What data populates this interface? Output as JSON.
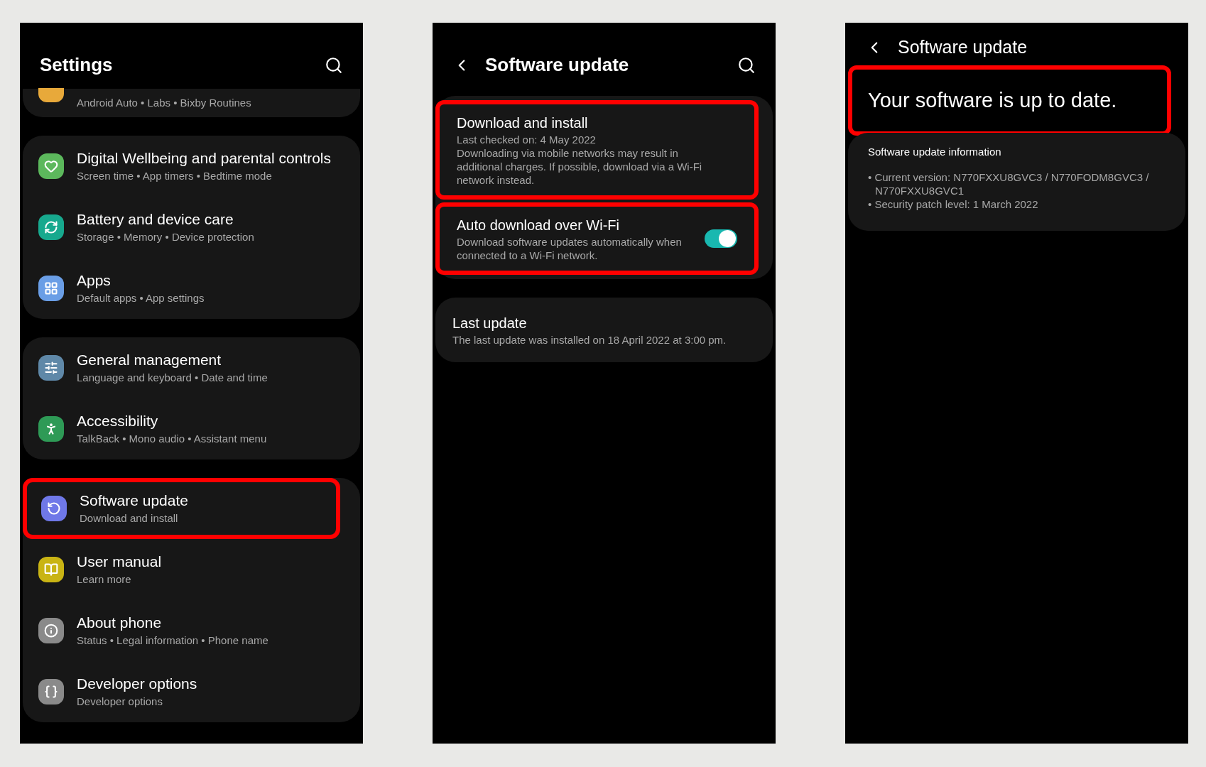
{
  "settings_screen": {
    "title": "Settings",
    "groups": [
      {
        "items": [
          {
            "subtitle": "Android Auto • Labs • Bixby Routines",
            "color": "#e8a93a",
            "highlighted": false,
            "partial": true
          }
        ]
      },
      {
        "items": [
          {
            "title": "Digital Wellbeing and parental controls",
            "subtitle": "Screen time • App timers • Bedtime mode",
            "color": "#5cb85c",
            "highlighted": false
          },
          {
            "title": "Battery and device care",
            "subtitle": "Storage • Memory • Device protection",
            "color": "#17a98e",
            "highlighted": false
          },
          {
            "title": "Apps",
            "subtitle": "Default apps • App settings",
            "color": "#6a9ee6",
            "highlighted": false
          }
        ]
      },
      {
        "items": [
          {
            "title": "General management",
            "subtitle": "Language and keyboard • Date and time",
            "color": "#5f88a8",
            "highlighted": false
          },
          {
            "title": "Accessibility",
            "subtitle": "TalkBack • Mono audio • Assistant menu",
            "color": "#2e9a56",
            "highlighted": false
          }
        ]
      },
      {
        "items": [
          {
            "title": "Software update",
            "subtitle": "Download and install",
            "color": "#6f78e8",
            "highlighted": true
          },
          {
            "title": "User manual",
            "subtitle": "Learn more",
            "color": "#c9b414",
            "highlighted": false
          },
          {
            "title": "About phone",
            "subtitle": "Status • Legal information • Phone name",
            "color": "#8a8a8a",
            "highlighted": false
          },
          {
            "title": "Developer options",
            "subtitle": "Developer options",
            "color": "#8a8a8a",
            "highlighted": false
          }
        ]
      }
    ]
  },
  "update_screen": {
    "title": "Software update",
    "cards": [
      {
        "items": [
          {
            "kind": "text",
            "title": "Download and install",
            "lines": [
              "Last checked on: 4 May 2022",
              "Downloading via mobile networks may result in additional charges. If possible, download via a Wi-Fi network instead."
            ],
            "highlighted": true
          },
          {
            "kind": "toggle",
            "title": "Auto download over Wi-Fi",
            "lines": [
              "Download software updates automatically when connected to a Wi-Fi network."
            ],
            "on": true,
            "highlighted": true
          }
        ]
      },
      {
        "items": [
          {
            "kind": "text",
            "title": "Last update",
            "lines": [
              "The last update was installed on 18 April 2022 at 3:00 pm."
            ],
            "highlighted": false
          }
        ]
      }
    ]
  },
  "status_screen": {
    "title": "Software update",
    "message": "Your software is up to date.",
    "message_highlighted": true,
    "info": {
      "heading": "Software update information",
      "bullets": [
        "• Current version: N770FXXU8GVC3 / N770FODM8GVC3 / N770FXXU8GVC1",
        "• Security patch level: 1 March 2022"
      ]
    }
  }
}
